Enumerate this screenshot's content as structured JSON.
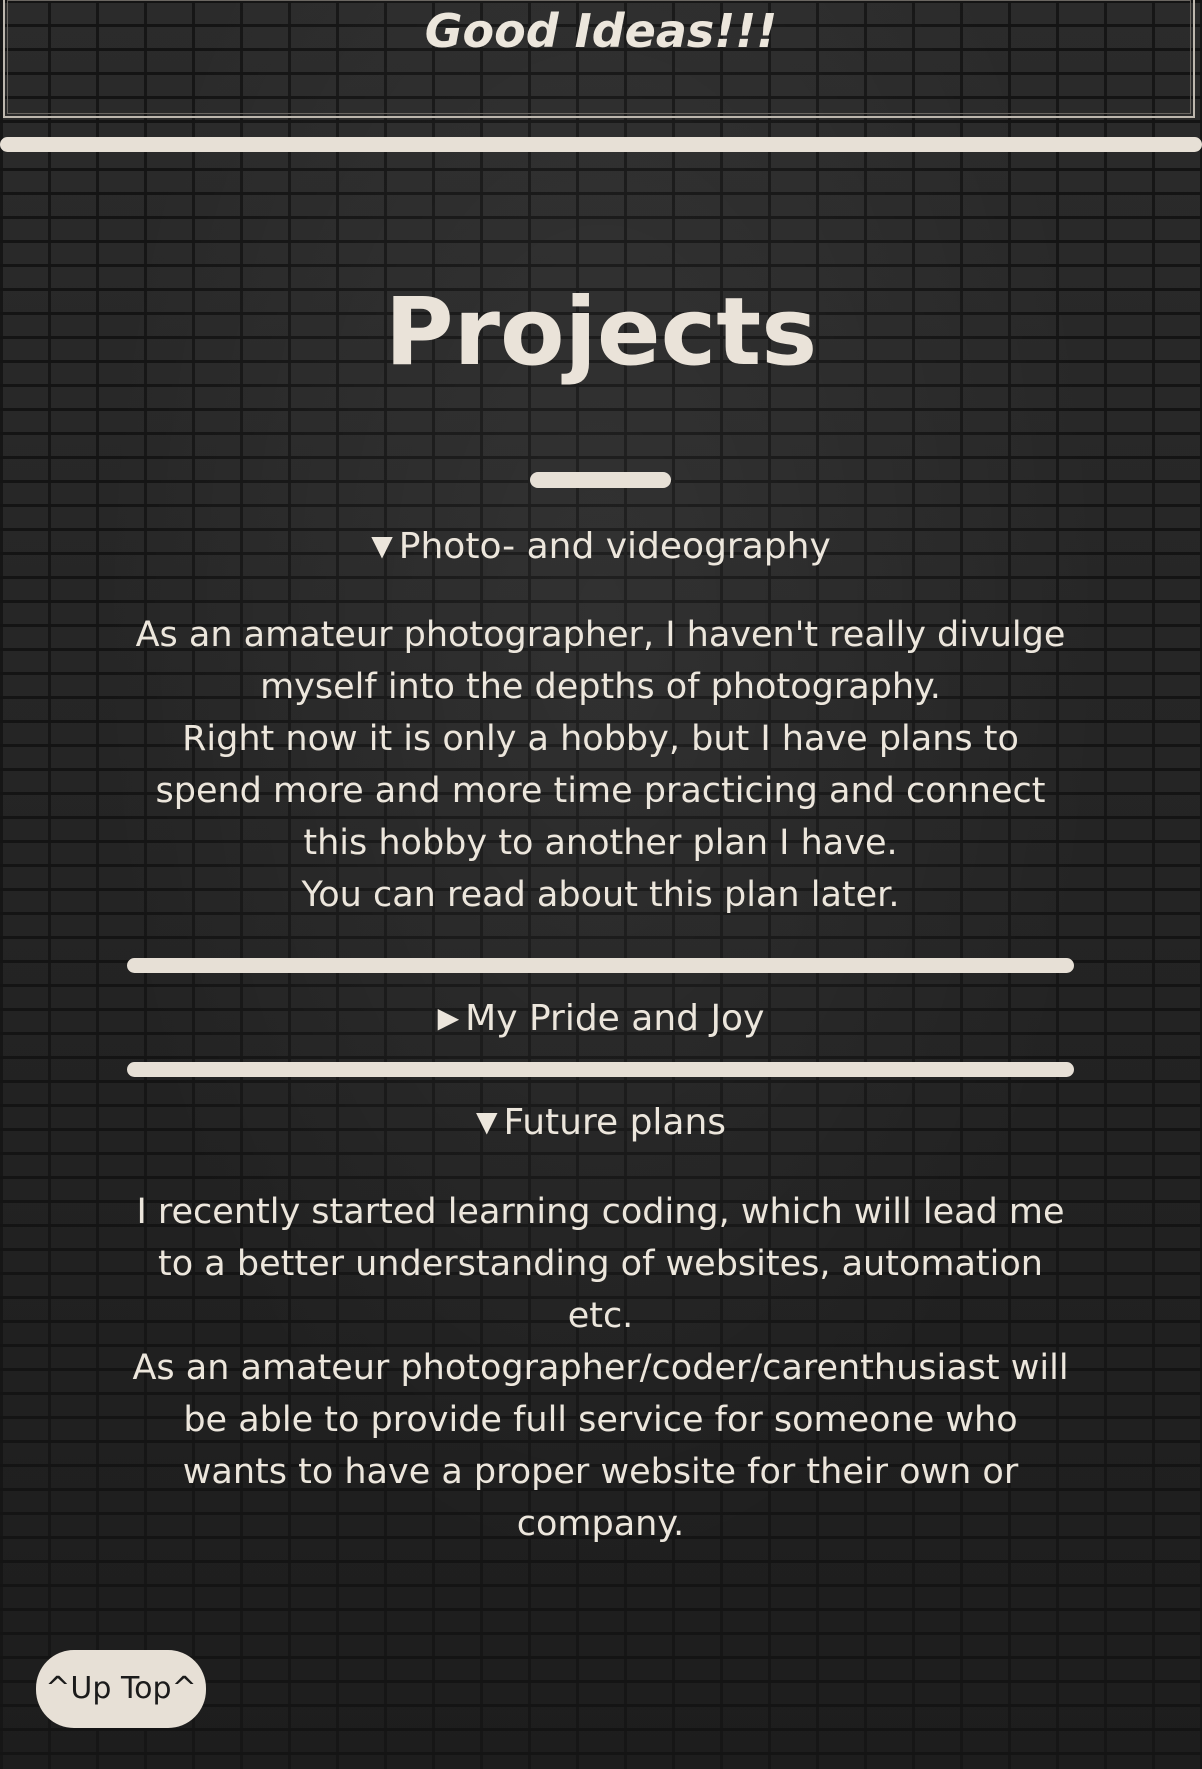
{
  "header": {
    "title": "Good Ideas!!!"
  },
  "main": {
    "title": "Projects",
    "sections": [
      {
        "summary": "Photo- and videography",
        "expanded": true,
        "marker": "▼",
        "paragraphs": [
          "As an amateur photographer, I haven't really divulge myself into the depths of photography.",
          "Right now it is only a hobby, but I have plans to spend more and more time practicing and connect this hobby to another plan I have.",
          "You can read about this plan later."
        ]
      },
      {
        "summary": "My Pride and Joy",
        "expanded": false,
        "marker": "▶"
      },
      {
        "summary": "Future plans",
        "expanded": true,
        "marker": "▼",
        "paragraphs": [
          "I recently started learning coding, which will lead me to a better understanding of websites, automation etc.",
          "As an amateur photographer/coder/carenthusiast will be able to provide full service for someone who wants to have a proper website for their own or company."
        ]
      }
    ]
  },
  "up_button": {
    "label": "^Up Top^"
  },
  "colors": {
    "text": "#e7e0d6",
    "background": "#232323",
    "button_text": "#1b1b1b"
  }
}
